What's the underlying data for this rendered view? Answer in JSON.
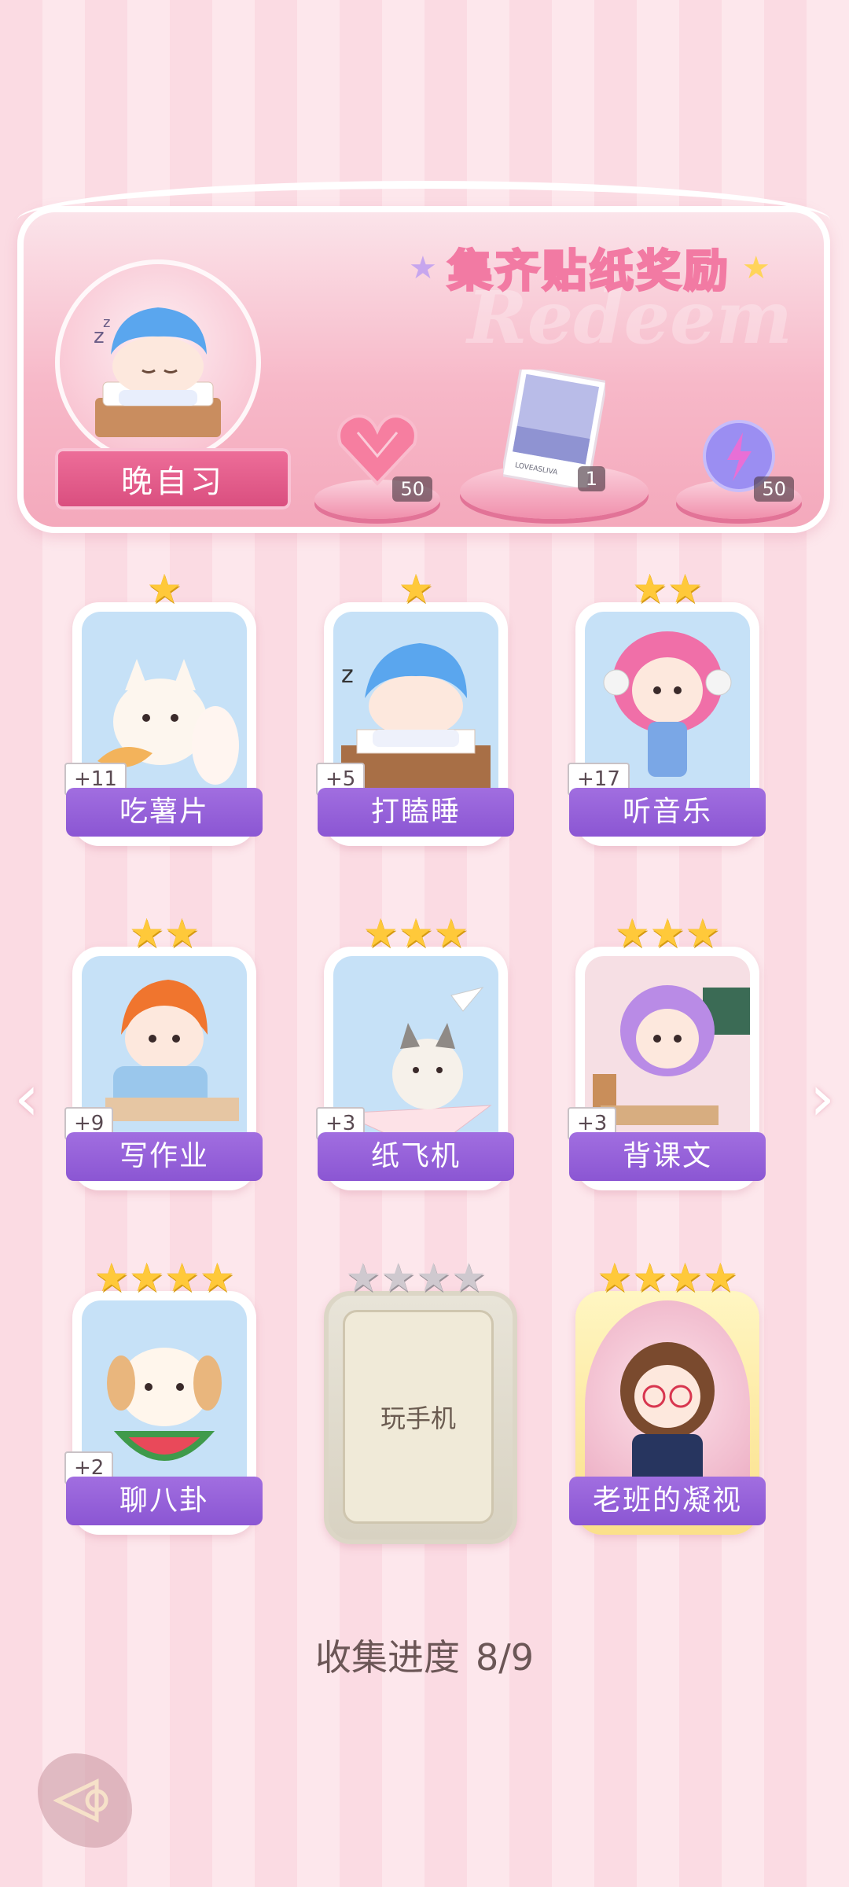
{
  "banner": {
    "title": "集齐贴纸奖励",
    "watermark": "Redeem",
    "task_label": "晚自习",
    "rewards": [
      {
        "icon": "heart-gem-icon",
        "count": "50"
      },
      {
        "icon": "postcard-icon",
        "count": "1"
      },
      {
        "icon": "energy-orb-icon",
        "count": "50"
      }
    ]
  },
  "stickers": [
    {
      "label": "吃薯片",
      "stars": 1,
      "bonus": "+11",
      "art": "fox-eating-chips"
    },
    {
      "label": "打瞌睡",
      "stars": 1,
      "bonus": "+5",
      "art": "boy-napping"
    },
    {
      "label": "听音乐",
      "stars": 2,
      "bonus": "+17",
      "art": "girl-headphones"
    },
    {
      "label": "写作业",
      "stars": 2,
      "bonus": "+9",
      "art": "boy-writing"
    },
    {
      "label": "纸飞机",
      "stars": 3,
      "bonus": "+3",
      "art": "cat-paper-plane"
    },
    {
      "label": "背课文",
      "stars": 3,
      "bonus": "+3",
      "art": "girl-classroom"
    },
    {
      "label": "聊八卦",
      "stars": 4,
      "bonus": "+2",
      "art": "puppy-watermelon"
    },
    {
      "label": "玩手机",
      "stars": 4,
      "locked": true
    },
    {
      "label": "老班的凝视",
      "stars": 4,
      "gold": true,
      "art": "teacher-glasses"
    }
  ],
  "progress": {
    "label": "收集进度",
    "value": "8/9"
  },
  "colors": {
    "accent": "#8b56d3",
    "pink": "#f08fac",
    "star": "#ffc93a"
  }
}
